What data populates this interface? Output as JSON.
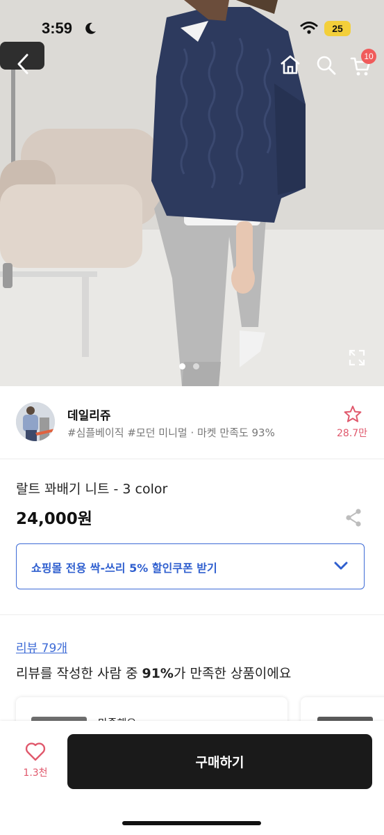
{
  "status_bar": {
    "time": "3:59",
    "battery": "25"
  },
  "header": {
    "cart_count": "10"
  },
  "gallery": {
    "page_count": 2,
    "current_page": 1
  },
  "seller": {
    "name": "데일리쥬",
    "tags": "#심플베이직 #모던 미니멀 · 마켓 만족도 93%",
    "favorite_count": "28.7만"
  },
  "product": {
    "title": "랄트 꽈배기 니트 - 3 color",
    "price": "24,000원"
  },
  "coupon": {
    "label": "쇼핑몰 전용 싹-쓰리 5% 할인쿠폰 받기"
  },
  "reviews": {
    "link_label": "리뷰 79개",
    "summary_prefix": "리뷰를 작성한 사람 중 ",
    "summary_percent": "91%",
    "summary_suffix": "가 만족한 상품이에요",
    "card_title": "만족해요"
  },
  "bottom": {
    "like_count": "1.3천",
    "buy_label": "구매하기"
  },
  "colors": {
    "accent_blue": "#3c6ad6",
    "like_pink": "#e0586c",
    "buy_bg": "#1a1a1a",
    "battery": "#f3cf3a"
  }
}
